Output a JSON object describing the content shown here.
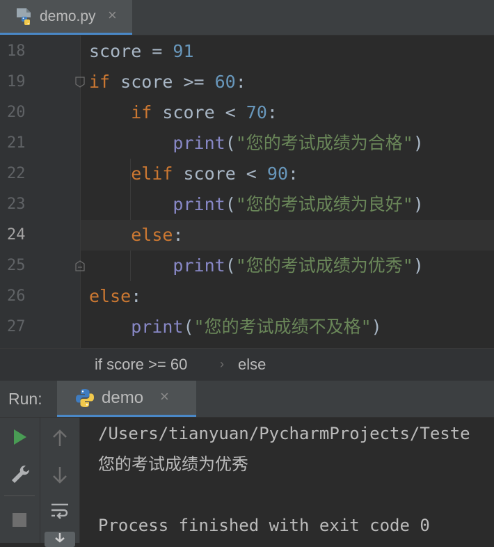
{
  "file_tab": {
    "name": "demo.py",
    "close": "×"
  },
  "editor": {
    "line_numbers": [
      "18",
      "19",
      "20",
      "21",
      "22",
      "23",
      "24",
      "25",
      "26",
      "27"
    ],
    "active_line": "24",
    "lines": [
      [
        {
          "t": "score = ",
          "c": ""
        },
        {
          "t": "91",
          "c": "num"
        }
      ],
      [
        {
          "t": "if",
          "c": "kw"
        },
        {
          "t": " score >= ",
          "c": ""
        },
        {
          "t": "60",
          "c": "num"
        },
        {
          "t": ":",
          "c": ""
        }
      ],
      [
        {
          "t": "    ",
          "c": ""
        },
        {
          "t": "if",
          "c": "kw"
        },
        {
          "t": " score < ",
          "c": ""
        },
        {
          "t": "70",
          "c": "num"
        },
        {
          "t": ":",
          "c": ""
        }
      ],
      [
        {
          "t": "        ",
          "c": ""
        },
        {
          "t": "print",
          "c": "fn"
        },
        {
          "t": "(",
          "c": ""
        },
        {
          "t": "\"您的考试成绩为合格\"",
          "c": "str"
        },
        {
          "t": ")",
          "c": ""
        }
      ],
      [
        {
          "t": "    ",
          "c": ""
        },
        {
          "t": "elif",
          "c": "kw"
        },
        {
          "t": " score < ",
          "c": ""
        },
        {
          "t": "90",
          "c": "num"
        },
        {
          "t": ":",
          "c": ""
        }
      ],
      [
        {
          "t": "        ",
          "c": ""
        },
        {
          "t": "print",
          "c": "fn"
        },
        {
          "t": "(",
          "c": ""
        },
        {
          "t": "\"您的考试成绩为良好\"",
          "c": "str"
        },
        {
          "t": ")",
          "c": ""
        }
      ],
      [
        {
          "t": "    ",
          "c": ""
        },
        {
          "t": "else",
          "c": "kw"
        },
        {
          "t": ":",
          "c": ""
        }
      ],
      [
        {
          "t": "        ",
          "c": ""
        },
        {
          "t": "print",
          "c": "fn"
        },
        {
          "t": "(",
          "c": ""
        },
        {
          "t": "\"您的考试成绩为优秀\"",
          "c": "str"
        },
        {
          "t": ")",
          "c": ""
        }
      ],
      [
        {
          "t": "else",
          "c": "kw"
        },
        {
          "t": ":",
          "c": ""
        }
      ],
      [
        {
          "t": "    ",
          "c": ""
        },
        {
          "t": "print",
          "c": "fn"
        },
        {
          "t": "(",
          "c": ""
        },
        {
          "t": "\"您的考试成绩不及格\"",
          "c": "str"
        },
        {
          "t": ")",
          "c": ""
        }
      ]
    ]
  },
  "breadcrumb": {
    "first": "if score >= 60",
    "separator": "›",
    "second": "else"
  },
  "run_panel": {
    "label": "Run:",
    "tab_name": "demo",
    "tab_close": "×",
    "console_lines": [
      "/Users/tianyuan/PycharmProjects/Teste",
      "您的考试成绩为优秀",
      "",
      "Process finished with exit code 0"
    ]
  },
  "icons": {
    "file_tab": "python-file-icon",
    "run_tab": "python-icon",
    "toolbar": [
      "run-icon",
      "wrench-icon",
      "stop-icon",
      "scroll-up-icon",
      "scroll-down-icon",
      "soft-wrap-icon",
      "scroll-to-end-icon"
    ]
  },
  "colors": {
    "keyword": "#cc7832",
    "number": "#6897bb",
    "builtin": "#8888c6",
    "string": "#6a8759",
    "text": "#a9b7c6",
    "editor_bg": "#2b2b2b",
    "panel_bg": "#3c3f41",
    "accent": "#4a88c7",
    "run_green": "#499c54"
  }
}
